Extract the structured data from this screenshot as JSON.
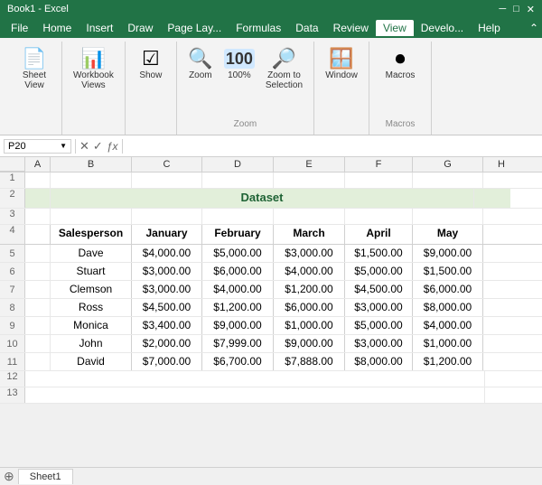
{
  "titlebar": {
    "text": "Book1 - Excel"
  },
  "menubar": {
    "items": [
      "File",
      "Home",
      "Insert",
      "Draw",
      "Page Layout",
      "Formulas",
      "Data",
      "Review",
      "View",
      "Developer",
      "Help"
    ]
  },
  "ribbon": {
    "active_tab": "View",
    "groups": [
      {
        "label": "",
        "buttons": [
          {
            "icon": "📄",
            "label": "Sheet\nView",
            "name": "sheet-view-btn"
          }
        ]
      },
      {
        "label": "",
        "buttons": [
          {
            "icon": "📗",
            "label": "Workbook\nViews",
            "name": "workbook-views-btn"
          }
        ]
      },
      {
        "label": "",
        "buttons": [
          {
            "icon": "☑",
            "label": "Show",
            "name": "show-btn"
          }
        ]
      },
      {
        "label": "Zoom",
        "buttons": [
          {
            "icon": "🔍",
            "label": "Zoom",
            "name": "zoom-btn"
          },
          {
            "icon": "💯",
            "label": "100%",
            "name": "zoom-100-btn"
          },
          {
            "icon": "🔎",
            "label": "Zoom to\nSelection",
            "name": "zoom-selection-btn"
          }
        ]
      },
      {
        "label": "",
        "buttons": [
          {
            "icon": "🪟",
            "label": "Window",
            "name": "window-btn"
          }
        ]
      },
      {
        "label": "Macros",
        "buttons": [
          {
            "icon": "⏺",
            "label": "Macros",
            "name": "macros-btn"
          }
        ]
      }
    ]
  },
  "formula_bar": {
    "name_box": "P20",
    "formula": ""
  },
  "spreadsheet": {
    "col_headers": [
      "A",
      "B",
      "C",
      "D",
      "E",
      "F",
      "G",
      "H"
    ],
    "rows": [
      {
        "num": "1",
        "cells": [
          "",
          "",
          "",
          "",
          "",
          "",
          "",
          ""
        ]
      },
      {
        "num": "2",
        "cells": [
          "",
          "",
          "",
          "Dataset",
          "",
          "",
          "",
          ""
        ],
        "type": "dataset-title"
      },
      {
        "num": "3",
        "cells": [
          "",
          "",
          "",
          "",
          "",
          "",
          "",
          ""
        ]
      },
      {
        "num": "4",
        "cells": [
          "",
          "Salesperson",
          "January",
          "February",
          "March",
          "April",
          "May",
          ""
        ],
        "type": "header"
      },
      {
        "num": "5",
        "cells": [
          "",
          "Dave",
          "$4,000.00",
          "$5,000.00",
          "$3,000.00",
          "$1,500.00",
          "$9,000.00",
          ""
        ]
      },
      {
        "num": "6",
        "cells": [
          "",
          "Stuart",
          "$3,000.00",
          "$6,000.00",
          "$4,000.00",
          "$5,000.00",
          "$1,500.00",
          ""
        ]
      },
      {
        "num": "7",
        "cells": [
          "",
          "Clemson",
          "$3,000.00",
          "$4,000.00",
          "$1,200.00",
          "$4,500.00",
          "$6,000.00",
          ""
        ]
      },
      {
        "num": "8",
        "cells": [
          "",
          "Ross",
          "$4,500.00",
          "$1,200.00",
          "$6,000.00",
          "$3,000.00",
          "$8,000.00",
          ""
        ]
      },
      {
        "num": "9",
        "cells": [
          "",
          "Monica",
          "$3,400.00",
          "$9,000.00",
          "$1,000.00",
          "$5,000.00",
          "$4,000.00",
          ""
        ]
      },
      {
        "num": "10",
        "cells": [
          "",
          "John",
          "$2,000.00",
          "$7,999.00",
          "$9,000.00",
          "$3,000.00",
          "$1,000.00",
          ""
        ]
      },
      {
        "num": "11",
        "cells": [
          "",
          "David",
          "$7,000.00",
          "$6,700.00",
          "$7,888.00",
          "$8,000.00",
          "$1,200.00",
          ""
        ]
      },
      {
        "num": "12",
        "cells": [
          "",
          "",
          "",
          "",
          "",
          "",
          "",
          ""
        ]
      },
      {
        "num": "13",
        "cells": [
          "",
          "",
          "",
          "",
          "",
          "",
          "",
          ""
        ]
      }
    ]
  }
}
